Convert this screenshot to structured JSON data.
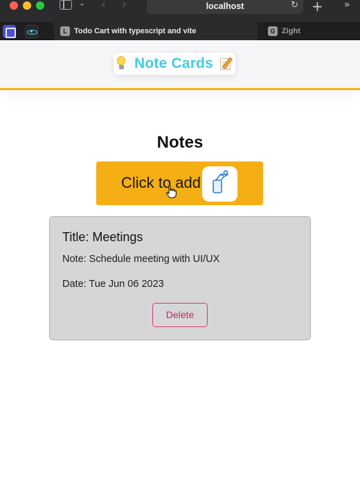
{
  "browser": {
    "address": "localhost",
    "tabs": [
      {
        "favicon_letter": "L",
        "title": "Todo Cart with typescript and vite",
        "active": true
      },
      {
        "favicon_letter": "G",
        "title": "Zight",
        "active": false
      }
    ],
    "icons": {
      "sidebar": "sidebar-toggle-icon",
      "back": "chevron-left-icon",
      "forward": "chevron-right-icon",
      "reload": "reload-icon",
      "new_tab": "plus-icon",
      "overflow": "double-chevron-right-icon"
    },
    "glyphs": {
      "sidebar_chevron": "⌄",
      "back": "‹",
      "forward": "›",
      "reload": "↻",
      "new_tab": "+",
      "overflow": "»"
    },
    "colors": {
      "close": "#fe5f57",
      "minimize": "#febc2e",
      "zoom": "#28c840"
    }
  },
  "app": {
    "brand": "Note Cards",
    "brand_color": "#43cbe3",
    "header_accent": "#f5b014",
    "brand_icons": [
      "lightbulb-icon",
      "memo-icon"
    ]
  },
  "main": {
    "section_title": "Notes",
    "add_button": {
      "label": "Click to add",
      "icon": "pushpin-icon",
      "color": "#f5ae14"
    },
    "notes": [
      {
        "title": "Title: Meetings",
        "note": "Note: Schedule meeting with UI/UX",
        "date": "Date: Tue Jun 06 2023",
        "delete_label": "Delete"
      }
    ],
    "delete_color": "#d63b63"
  }
}
